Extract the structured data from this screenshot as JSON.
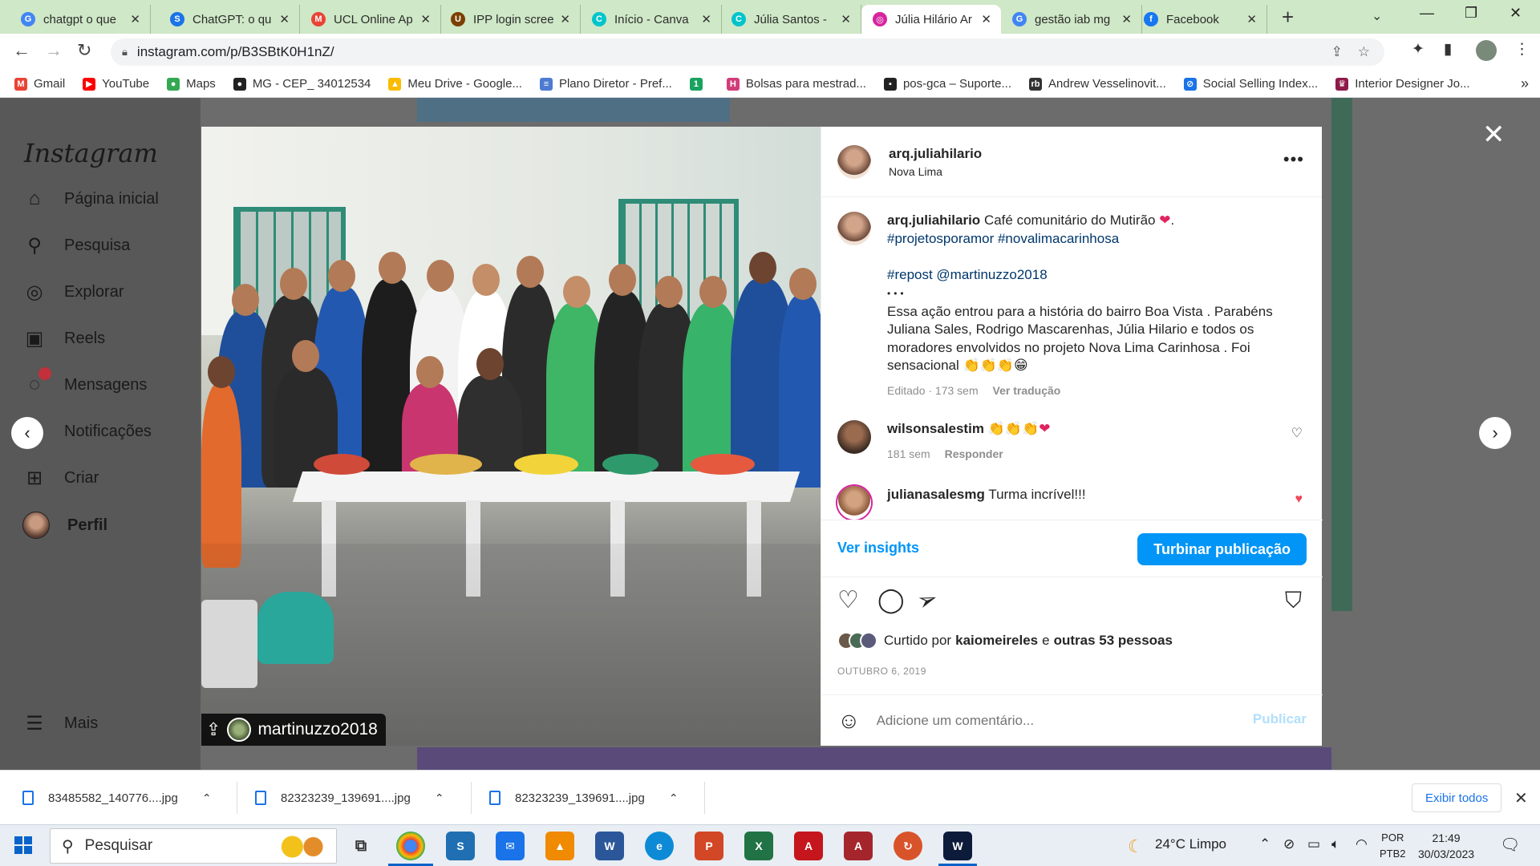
{
  "tabs": [
    {
      "title": "chatgpt o que",
      "fav_color": "#4285f4",
      "fav_letter": "G"
    },
    {
      "title": "ChatGPT: o qu",
      "fav_color": "#1a73e8",
      "fav_letter": "S"
    },
    {
      "title": "UCL Online Ap",
      "fav_color": "#ea4335",
      "fav_letter": "M"
    },
    {
      "title": "IPP login scree",
      "fav_color": "#7b3f00",
      "fav_letter": "U"
    },
    {
      "title": "Início - Canva",
      "fav_color": "#00c4cc",
      "fav_letter": "C"
    },
    {
      "title": "Júlia Santos - ",
      "fav_color": "#00c4cc",
      "fav_letter": "C"
    },
    {
      "title": "Júlia Hilário Ar",
      "fav_color": "#d6249f",
      "fav_letter": "◎"
    },
    {
      "title": "gestão iab mg",
      "fav_color": "#4285f4",
      "fav_letter": "G"
    },
    {
      "title": "Facebook",
      "fav_color": "#1877f2",
      "fav_letter": "f"
    }
  ],
  "address": {
    "url": "instagram.com/p/B3SBtK0H1nZ/"
  },
  "bookmarks": [
    {
      "label": "Gmail",
      "color": "#ea4335",
      "letter": "M"
    },
    {
      "label": "YouTube",
      "color": "#ff0000",
      "letter": "▶"
    },
    {
      "label": "Maps",
      "color": "#34a853",
      "letter": "●"
    },
    {
      "label": "MG - CEP_ 34012534",
      "color": "#222222",
      "letter": "●"
    },
    {
      "label": "Meu Drive - Google...",
      "color": "#fbbc04",
      "letter": "▲"
    },
    {
      "label": "Plano Diretor - Pref...",
      "color": "#4d7bd1",
      "letter": "≡"
    },
    {
      "label": "",
      "color": "#1aa260",
      "letter": "1"
    },
    {
      "label": "Bolsas para mestrad...",
      "color": "#d23c7a",
      "letter": "H"
    },
    {
      "label": "pos-gca – Suporte...",
      "color": "#222222",
      "letter": "▪"
    },
    {
      "label": "Andrew Vesselinovit...",
      "color": "#333333",
      "letter": "rb"
    },
    {
      "label": "Social Selling Index...",
      "color": "#1a73e8",
      "letter": "⊘"
    },
    {
      "label": "Interior Designer Jo...",
      "color": "#8e1a4a",
      "letter": "♛"
    }
  ],
  "sidebar": {
    "logo": "Instagram",
    "items": [
      {
        "label": "Página inicial",
        "icon": "home-icon",
        "glyph": "⌂"
      },
      {
        "label": "Pesquisa",
        "icon": "search-icon",
        "glyph": "⚲"
      },
      {
        "label": "Explorar",
        "icon": "compass-icon",
        "glyph": "◎"
      },
      {
        "label": "Reels",
        "icon": "reels-icon",
        "glyph": "▣"
      },
      {
        "label": "Mensagens",
        "icon": "messenger-icon",
        "glyph": "◌"
      },
      {
        "label": "Notificações",
        "icon": "heart-icon",
        "glyph": "♡"
      },
      {
        "label": "Criar",
        "icon": "plus-square-icon",
        "glyph": "⊞"
      },
      {
        "label": "Perfil",
        "icon": "avatar",
        "glyph": ""
      }
    ],
    "more": "Mais"
  },
  "post": {
    "username": "arq.juliahilario",
    "location": "Nova Lima",
    "caption_text": "Café comunitário do Mutirão",
    "caption_hashtags": "#projetosporamor #novalimacarinhosa",
    "repost": "#repost @martinuzzo2018",
    "body": "Essa ação entrou para a história do bairro Boa Vista . Parabéns Juliana Sales, Rodrigo Mascarenhas, Júlia Hilario e todos os moradores envolvidos no projeto Nova Lima Carinhosa . Foi sensacional",
    "edited": "Editado · 173 sem",
    "translate": "Ver tradução",
    "photo_tag": "martinuzzo2018"
  },
  "comments": [
    {
      "user": "wilsonsalestim",
      "text": "",
      "time": "181 sem",
      "reply": "Responder",
      "liked": false
    },
    {
      "user": "julianasalesmg",
      "text": "Turma incrível!!!",
      "time": "",
      "reply": "",
      "liked": true
    }
  ],
  "insights": {
    "link": "Ver insights",
    "boost": "Turbinar publicação"
  },
  "likes": {
    "prefix": "Curtido por",
    "user": "kaiomeireles",
    "conj": "e",
    "others": "outras 53 pessoas"
  },
  "date": "OUTUBRO 6, 2019",
  "comment_box": {
    "placeholder": "Adicione um comentário...",
    "publish": "Publicar"
  },
  "downloads": [
    {
      "name": "83485582_140776....jpg"
    },
    {
      "name": "82323239_139691....jpg"
    },
    {
      "name": "82323239_139691....jpg"
    }
  ],
  "downloads_show_all": "Exibir todos",
  "taskbar": {
    "search": "Pesquisar",
    "weather": "24°C  Limpo",
    "lang1": "POR",
    "lang2": "PTB2",
    "time": "21:49",
    "date": "30/03/2023"
  }
}
